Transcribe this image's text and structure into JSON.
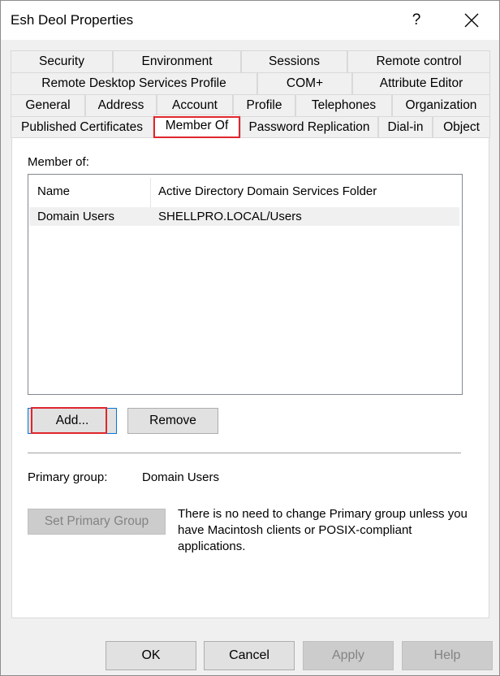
{
  "window": {
    "title": "Esh Deol Properties"
  },
  "titlebar": {
    "help_label": "?"
  },
  "tabs": {
    "row1": [
      {
        "label": "Security"
      },
      {
        "label": "Environment"
      },
      {
        "label": "Sessions"
      },
      {
        "label": "Remote control"
      }
    ],
    "row2": [
      {
        "label": "Remote Desktop Services Profile"
      },
      {
        "label": "COM+"
      },
      {
        "label": "Attribute Editor"
      }
    ],
    "row3": [
      {
        "label": "General"
      },
      {
        "label": "Address"
      },
      {
        "label": "Account"
      },
      {
        "label": "Profile"
      },
      {
        "label": "Telephones"
      },
      {
        "label": "Organization"
      }
    ],
    "row4": [
      {
        "label": "Published Certificates"
      },
      {
        "label": "Member Of"
      },
      {
        "label": "Password Replication"
      },
      {
        "label": "Dial-in"
      },
      {
        "label": "Object"
      }
    ],
    "active": "Member Of"
  },
  "member_of": {
    "label": "Member of:",
    "columns": [
      "Name",
      "Active Directory Domain Services Folder"
    ],
    "rows": [
      {
        "name": "Domain Users",
        "folder": "SHELLPRO.LOCAL/Users"
      }
    ]
  },
  "buttons": {
    "add": "Add...",
    "remove": "Remove",
    "set_primary_group": "Set Primary Group",
    "ok": "OK",
    "cancel": "Cancel",
    "apply": "Apply",
    "help": "Help"
  },
  "primary_group": {
    "label": "Primary group:",
    "value": "Domain Users",
    "info": "There is no need to change Primary group unless you have Macintosh clients or POSIX-compliant applications."
  },
  "colors": {
    "highlight": "#e0262d",
    "focus_border": "#0078d7"
  }
}
